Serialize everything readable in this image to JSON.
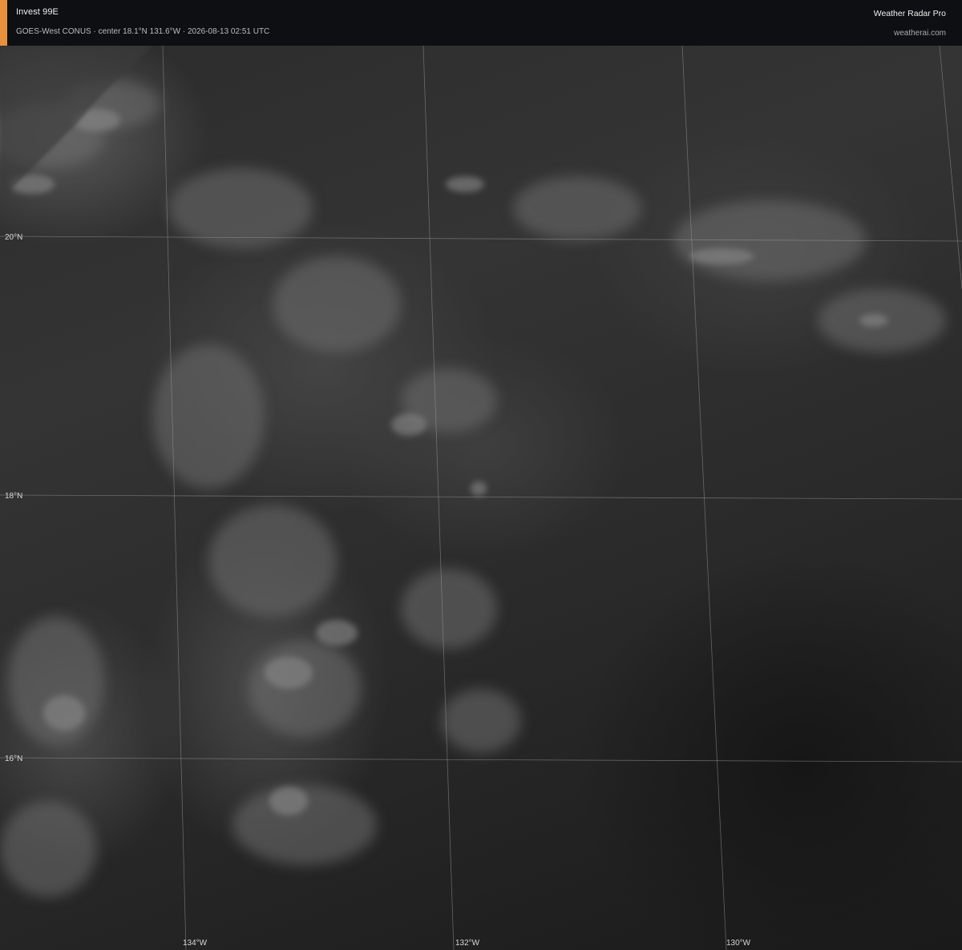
{
  "header": {
    "storm_name": "Invest 99E",
    "subtitle": "GOES-West CONUS · center 18.1°N 131.6°W · 2026-08-13 02:51 UTC",
    "app_name": "Weather Radar Pro",
    "site_url": "weatherai.com",
    "accent_color": "#e8913a"
  },
  "map": {
    "latitude_labels": [
      "20°N",
      "18°N",
      "16°N"
    ],
    "longitude_labels": [
      "134°W",
      "132°W",
      "130°W"
    ]
  }
}
